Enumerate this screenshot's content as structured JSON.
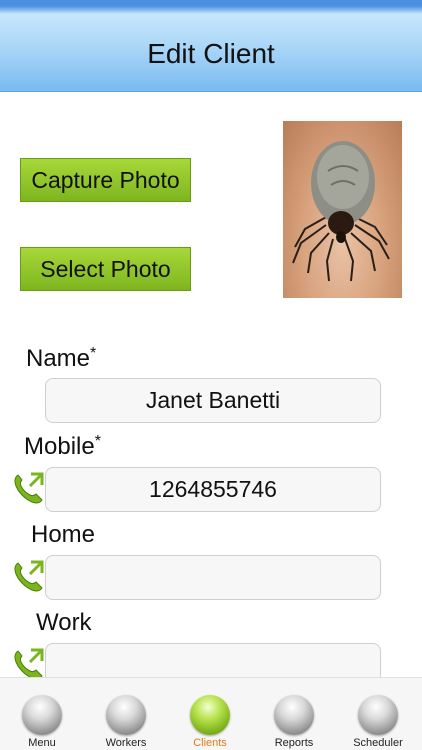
{
  "header": {
    "title": "Edit Client"
  },
  "photo_actions": {
    "capture_label": "Capture Photo",
    "select_label": "Select Photo"
  },
  "form": {
    "name": {
      "label": "Name",
      "required_mark": "*",
      "value": "Janet Banetti"
    },
    "mobile": {
      "label": "Mobile",
      "required_mark": "*",
      "value": "1264855746"
    },
    "home": {
      "label": "Home",
      "value": ""
    },
    "work": {
      "label": "Work",
      "value": ""
    }
  },
  "tabbar": {
    "items": [
      {
        "label": "Menu",
        "active": false
      },
      {
        "label": "Workers",
        "active": false
      },
      {
        "label": "Clients",
        "active": true
      },
      {
        "label": "Reports",
        "active": false
      },
      {
        "label": "Scheduler",
        "active": false
      }
    ],
    "active_color": "#e07b1a",
    "accent_green": "#8cc63f"
  },
  "icons": {
    "phone": "phone-call-icon",
    "photo": "client-photo"
  }
}
